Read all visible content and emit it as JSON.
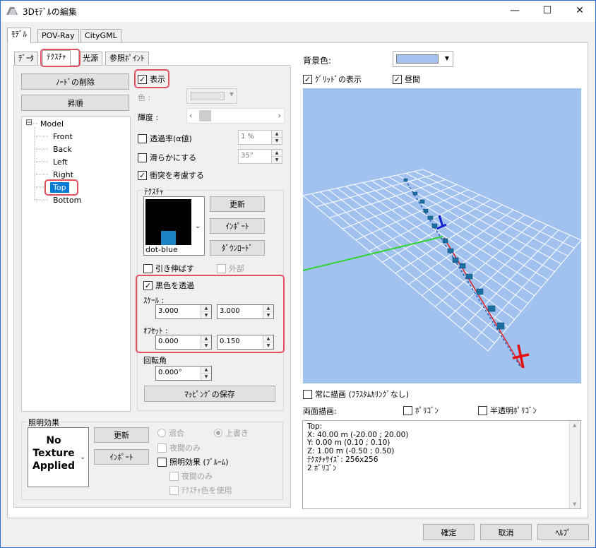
{
  "window": {
    "title": "3Dﾓﾃﾞﾙの編集",
    "minimize": "—",
    "maximize": "☐",
    "close": "✕"
  },
  "main_tabs": [
    "ﾓﾃﾞﾙ",
    "POV-Ray",
    "CityGML"
  ],
  "sub_tabs": [
    "ﾃﾞｰﾀ",
    "ﾃｸｽﾁｬ",
    "光源",
    "参照ﾎﾟｲﾝﾄ"
  ],
  "left": {
    "delete_node": "ﾉｰﾄﾞの削除",
    "sort_asc": "昇順",
    "tree": {
      "root": "Model",
      "toggle": "⊟",
      "children": [
        "Front",
        "Back",
        "Left",
        "Right",
        "Top",
        "Bottom"
      ],
      "selected": "Top"
    }
  },
  "texture": {
    "display_label": "表示",
    "color_label": "色 :",
    "brightness_label": "輝度 :",
    "transparency_label": "透過率(α値)",
    "transparency_value": "1 %",
    "smooth_label": "滑らかにする",
    "smooth_value": "35°",
    "collision_label": "衝突を考慮する",
    "group_label": "ﾃｸｽﾁｬ",
    "texture_name": "dot-blue",
    "update": "更新",
    "import": "ｲﾝﾎﾟｰﾄ",
    "download": "ﾀﾞｳﾝﾛｰﾄﾞ",
    "stretch_label": "引き伸ばす",
    "external_label": "外部",
    "black_transparent_label": "黒色を透過",
    "scale_label": "ｽｹｰﾙ :",
    "scale_x": "3.000",
    "scale_y": "3.000",
    "offset_label": "ｵﾌｾｯﾄ :",
    "offset_x": "0.000",
    "offset_y": "0.150",
    "rotation_label": "回転角",
    "rotation_value": "0.000°",
    "save_mapping": "ﾏｯﾋﾟﾝｸﾞの保存"
  },
  "lighting": {
    "group_label": "照明効果",
    "preview_text": "No Texture Applied",
    "update": "更新",
    "import": "ｲﾝﾎﾟｰﾄ",
    "mix": "混合",
    "overwrite": "上書き",
    "night_only": "夜間のみ",
    "bloom": "照明効果 (ﾌﾞﾙｰﾑ)",
    "bloom_night_only": "夜間のみ",
    "use_texture_color": "ﾃｸｽﾁｬ色を使用"
  },
  "view": {
    "bg_label": "背景色:",
    "bg_color": "#a3c2f0",
    "grid_label": "ｸﾞﾘｯﾄﾞの表示",
    "daytime_label": "昼間",
    "viewport_bg": "#a1c1ef",
    "always_draw": "常に描画 (ﾌﾗｽﾀﾑｶﾘﾝｸﾞなし)",
    "double_sided": "両面描画:",
    "polygon": "ﾎﾟﾘｺﾞﾝ",
    "semi_transparent": "半透明ﾎﾟﾘｺﾞﾝ",
    "info_lines": [
      "Top:",
      "X: 40.00 m (-20.00 ; 20.00)",
      "Y: 0.00 m (0.10 ; 0.10)",
      "Z: 1.00 m (-0.50 ; 0.50)",
      "ﾃｸｽﾁｬｻｲｽﾞ: 256x256",
      "2 ﾎﾟﾘｺﾞﾝ"
    ]
  },
  "footer": {
    "ok": "確定",
    "cancel": "取消",
    "help": "ﾍﾙﾌﾟ"
  }
}
